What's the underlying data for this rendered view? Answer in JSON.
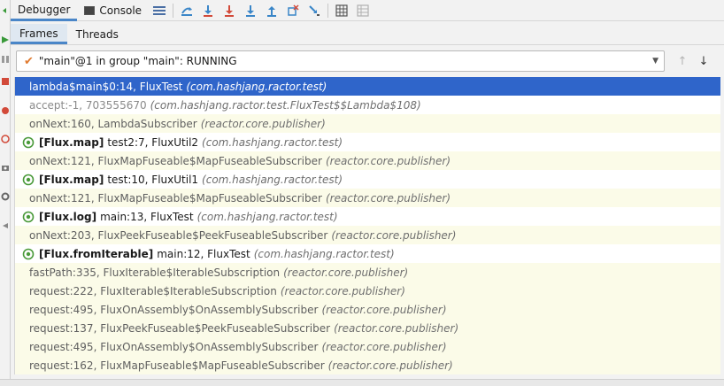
{
  "toolbar": {
    "tabs": [
      {
        "label": "Debugger",
        "active": true
      },
      {
        "label": "Console",
        "active": false
      }
    ],
    "icons": [
      "menu-icon",
      "show-execution-point-icon",
      "step-over-icon",
      "step-into-icon",
      "step-out-icon",
      "drop-frame-icon",
      "run-to-cursor-icon",
      "evaluate-icon",
      "trace-icon"
    ]
  },
  "subtabs": [
    {
      "label": "Frames",
      "active": true
    },
    {
      "label": "Threads",
      "active": false
    }
  ],
  "thread": {
    "label": "\"main\"@1 in group \"main\": RUNNING"
  },
  "frames": [
    {
      "kind": "selected",
      "text": "lambda$main$0:14, FluxTest",
      "pkg": "(com.hashjang.ractor.test)"
    },
    {
      "kind": "dim",
      "text": "accept:-1, 703555670",
      "pkg": "(com.hashjang.ractor.test.FluxTest$$Lambda$108)"
    },
    {
      "kind": "normal",
      "text": "onNext:160, LambdaSubscriber",
      "pkg": "(reactor.core.publisher)"
    },
    {
      "kind": "stream",
      "tag": "[Flux.map]",
      "text": "test2:7, FluxUtil2",
      "pkg": "(com.hashjang.ractor.test)"
    },
    {
      "kind": "normal",
      "text": "onNext:121, FluxMapFuseable$MapFuseableSubscriber",
      "pkg": "(reactor.core.publisher)"
    },
    {
      "kind": "stream",
      "tag": "[Flux.map]",
      "text": "test:10, FluxUtil1",
      "pkg": "(com.hashjang.ractor.test)"
    },
    {
      "kind": "normal",
      "text": "onNext:121, FluxMapFuseable$MapFuseableSubscriber",
      "pkg": "(reactor.core.publisher)"
    },
    {
      "kind": "stream",
      "tag": "[Flux.log]",
      "text": "main:13, FluxTest",
      "pkg": "(com.hashjang.ractor.test)"
    },
    {
      "kind": "normal",
      "text": "onNext:203, FluxPeekFuseable$PeekFuseableSubscriber",
      "pkg": "(reactor.core.publisher)"
    },
    {
      "kind": "stream",
      "tag": "[Flux.fromIterable]",
      "text": "main:12, FluxTest",
      "pkg": "(com.hashjang.ractor.test)"
    },
    {
      "kind": "normal",
      "text": "fastPath:335, FluxIterable$IterableSubscription",
      "pkg": "(reactor.core.publisher)"
    },
    {
      "kind": "normal",
      "text": "request:222, FluxIterable$IterableSubscription",
      "pkg": "(reactor.core.publisher)"
    },
    {
      "kind": "normal",
      "text": "request:495, FluxOnAssembly$OnAssemblySubscriber",
      "pkg": "(reactor.core.publisher)"
    },
    {
      "kind": "normal",
      "text": "request:137, FluxPeekFuseable$PeekFuseableSubscriber",
      "pkg": "(reactor.core.publisher)"
    },
    {
      "kind": "normal",
      "text": "request:495, FluxOnAssembly$OnAssemblySubscriber",
      "pkg": "(reactor.core.publisher)"
    },
    {
      "kind": "normal",
      "text": "request:162, FluxMapFuseable$MapFuseableSubscriber",
      "pkg": "(reactor.core.publisher)"
    }
  ],
  "colors": {
    "selected_bg": "#2f65ca",
    "frame_bg": "#fbfbe8",
    "stream_icon": "#4a9a3a",
    "accent": "#4a86c8"
  }
}
